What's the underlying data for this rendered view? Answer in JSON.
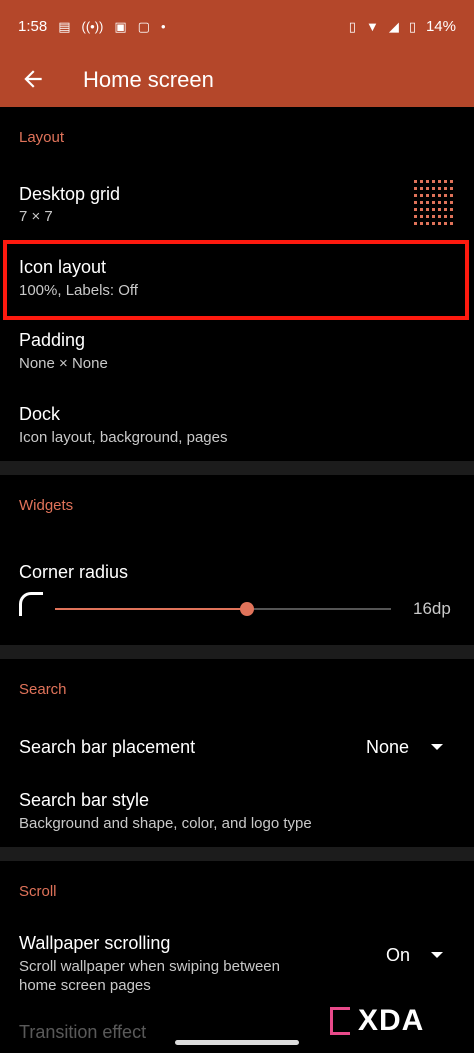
{
  "status_bar": {
    "time": "1:58",
    "battery": "14%"
  },
  "app_bar": {
    "title": "Home screen"
  },
  "sections": {
    "layout": "Layout",
    "widgets": "Widgets",
    "search": "Search",
    "scroll": "Scroll"
  },
  "layout": {
    "desktop_grid": {
      "title": "Desktop grid",
      "value": "7 × 7"
    },
    "icon_layout": {
      "title": "Icon layout",
      "value": "100%, Labels: Off"
    },
    "padding": {
      "title": "Padding",
      "value": "None × None"
    },
    "dock": {
      "title": "Dock",
      "value": "Icon layout, background, pages"
    }
  },
  "widgets": {
    "corner_radius": {
      "title": "Corner radius",
      "value": "16dp",
      "fraction": 0.57
    }
  },
  "search": {
    "placement": {
      "title": "Search bar placement",
      "value": "None"
    },
    "style": {
      "title": "Search bar style",
      "value": "Background and shape, color, and logo type"
    }
  },
  "scroll": {
    "wallpaper": {
      "title": "Wallpaper scrolling",
      "value_line1": "Scroll wallpaper when swiping between",
      "value_line2": "home screen pages",
      "selected": "On"
    },
    "transition": {
      "title": "Transition effect"
    }
  },
  "watermark": {
    "text": "XDA"
  },
  "colors": {
    "accent": "#e0735a",
    "appbar": "#b4472a",
    "highlight": "#ff1a0f"
  }
}
